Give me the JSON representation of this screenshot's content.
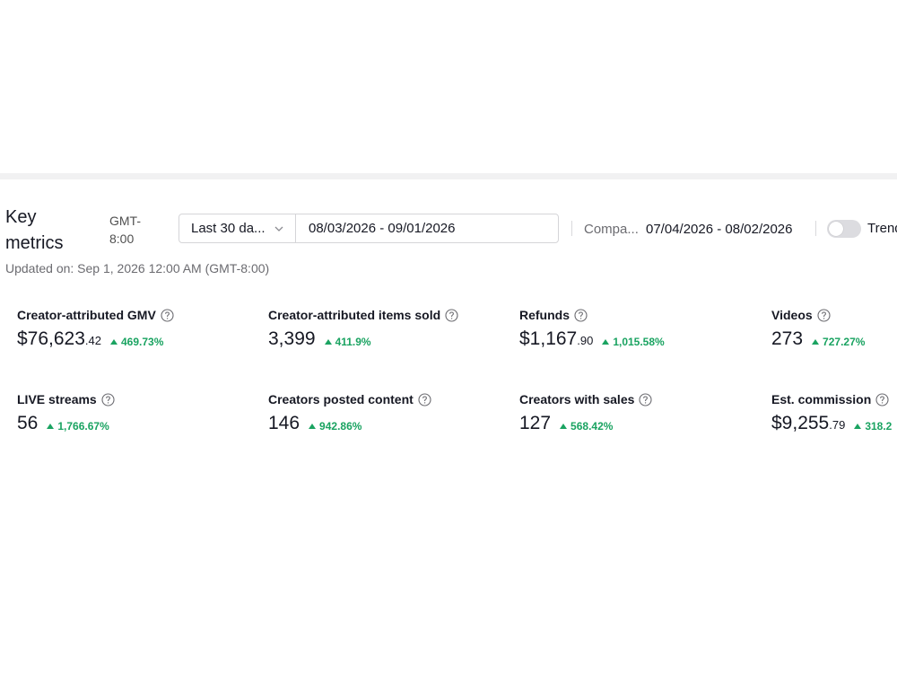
{
  "header": {
    "title_line1": "Key",
    "title_line2": "metrics",
    "timezone_line1": "GMT-",
    "timezone_line2": "8:00",
    "range_preset": "Last 30 da...",
    "date_range": "08/03/2026 - 09/01/2026",
    "compare_label": "Compa...",
    "compare_range": "07/04/2026 - 08/02/2026",
    "trend_label": "Trend",
    "trend_on": false,
    "updated_on": "Updated on: Sep 1, 2026 12:00 AM (GMT-8:00)"
  },
  "colors": {
    "positive": "#1aa361",
    "text": "#161823",
    "muted": "#6b6b70"
  },
  "metrics": [
    {
      "label": "Creator-attributed GMV",
      "value_main": "$76,623",
      "value_dec": ".42",
      "delta": "469.73%"
    },
    {
      "label": "Creator-attributed items sold",
      "value_main": "3,399",
      "value_dec": "",
      "delta": "411.9%"
    },
    {
      "label": "Refunds",
      "value_main": "$1,167",
      "value_dec": ".90",
      "delta": "1,015.58%"
    },
    {
      "label": "Videos",
      "value_main": "273",
      "value_dec": "",
      "delta": "727.27%"
    },
    {
      "label": "LIVE streams",
      "value_main": "56",
      "value_dec": "",
      "delta": "1,766.67%"
    },
    {
      "label": "Creators posted content",
      "value_main": "146",
      "value_dec": "",
      "delta": "942.86%"
    },
    {
      "label": "Creators with sales",
      "value_main": "127",
      "value_dec": "",
      "delta": "568.42%"
    },
    {
      "label": "Est. commission",
      "value_main": "$9,255",
      "value_dec": ".79",
      "delta": "318.2"
    }
  ]
}
